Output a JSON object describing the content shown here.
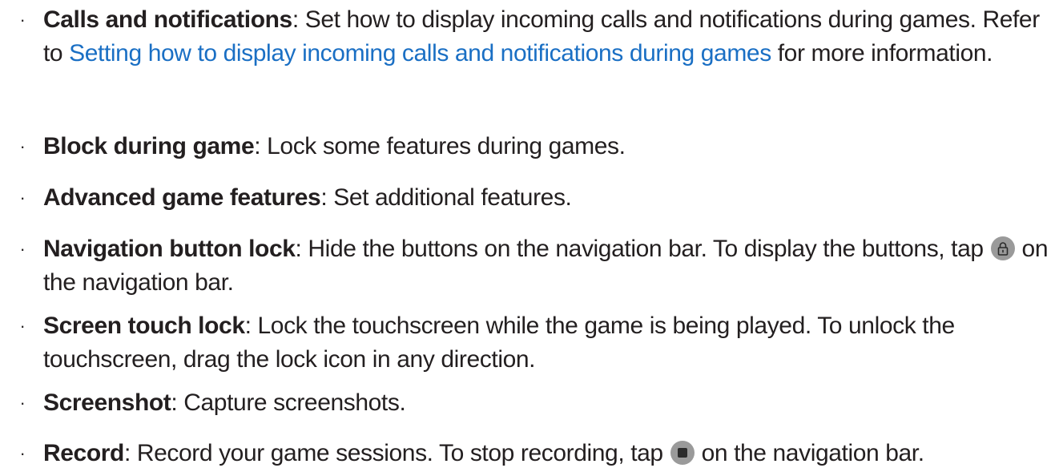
{
  "bullet_char": "·",
  "colors": {
    "text": "#231f20",
    "link": "#1a6fc4",
    "icon_circle": "#9a9a9a"
  },
  "items": [
    {
      "term": "Calls and notifications",
      "text_before_link": ": Set how to display incoming calls and notifications during games. Refer to ",
      "link": "Setting how to display incoming calls and notifications during games",
      "text_after_link": " for more information."
    },
    {
      "term": "Block during game",
      "text": ": Lock some features during games."
    },
    {
      "term": "Advanced game features",
      "text": ": Set additional features."
    },
    {
      "term": "Navigation button lock",
      "text_before_icon": ": Hide the buttons on the navigation bar. To display the buttons, tap ",
      "icon": "lock-icon",
      "text_after_icon": " on the navigation bar."
    },
    {
      "term": "Screen touch lock",
      "text": ": Lock the touchscreen while the game is being played. To unlock the touchscreen, drag the lock icon in any direction."
    },
    {
      "term": "Screenshot",
      "text": ": Capture screenshots."
    },
    {
      "term": "Record",
      "text_before_icon": ": Record your game sessions. To stop recording, tap ",
      "icon": "stop-icon",
      "text_after_icon": " on the navigation bar."
    }
  ]
}
